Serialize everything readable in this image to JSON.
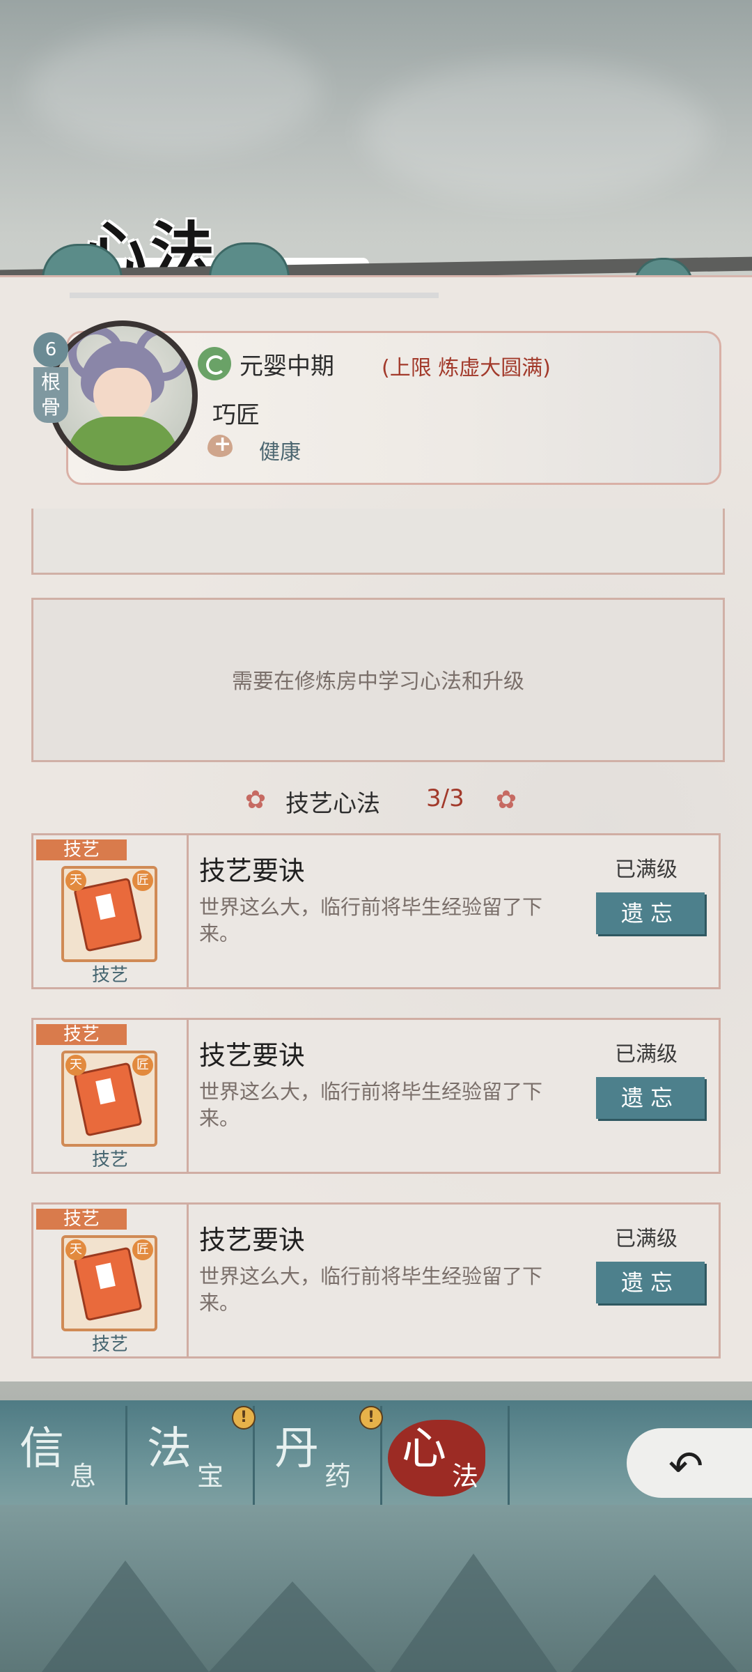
{
  "page": {
    "title": "心法"
  },
  "character": {
    "root_level": "6",
    "root_label": "根骨",
    "realm": "元婴中期",
    "realm_limit": "(上限 炼虚大圆满)",
    "profession": "巧匠",
    "health": "健康"
  },
  "notice": {
    "text": "需要在修炼房中学习心法和升级"
  },
  "section": {
    "title": "技艺心法",
    "count": "3/3"
  },
  "skills": [
    {
      "tag": "技艺",
      "badge_left": "天",
      "badge_right": "匠",
      "subtitle": "技艺",
      "name": "技艺要诀",
      "description": "世界这么大，临行前将毕生经验留了下来。",
      "status": "已满级",
      "button": "遗忘"
    },
    {
      "tag": "技艺",
      "badge_left": "天",
      "badge_right": "匠",
      "subtitle": "技艺",
      "name": "技艺要诀",
      "description": "世界这么大，临行前将毕生经验留了下来。",
      "status": "已满级",
      "button": "遗忘"
    },
    {
      "tag": "技艺",
      "badge_left": "天",
      "badge_right": "匠",
      "subtitle": "技艺",
      "name": "技艺要诀",
      "description": "世界这么大，临行前将毕生经验留了下来。",
      "status": "已满级",
      "button": "遗忘"
    }
  ],
  "nav": [
    {
      "main": "信",
      "sub": "息",
      "active": false,
      "alert": false
    },
    {
      "main": "法",
      "sub": "宝",
      "active": false,
      "alert": true,
      "alert_symbol": "!"
    },
    {
      "main": "丹",
      "sub": "药",
      "active": false,
      "alert": true,
      "alert_symbol": "!"
    },
    {
      "main": "心",
      "sub": "法",
      "active": true,
      "alert": false
    }
  ],
  "back_button": {
    "icon": "back-arrow-icon",
    "glyph": "↶"
  },
  "colors": {
    "accent_teal": "#4d808c",
    "accent_red": "#a23a2b",
    "tag_orange": "#d97b4c"
  }
}
